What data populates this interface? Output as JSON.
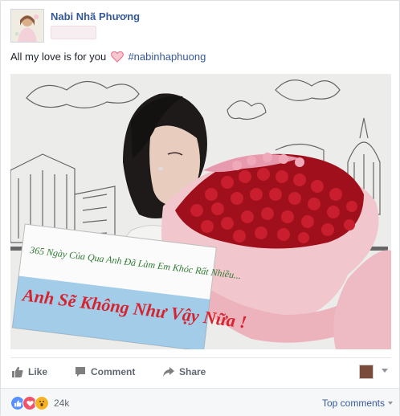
{
  "post": {
    "author": "Nabi Nhã Phương",
    "status_text": "All my love is for you",
    "hashtag": "#nabinhaphuong",
    "photo_sign_line1": "365 Ngày Của Qua Anh Đã Làm Em Khóc Rất Nhiều...",
    "photo_sign_line2": "Anh Sẽ Không Như Vậy Nữa !"
  },
  "actions": {
    "like": "Like",
    "comment": "Comment",
    "share": "Share"
  },
  "footer": {
    "reaction_count": "24k",
    "top_comments": "Top comments"
  },
  "colors": {
    "link": "#365899",
    "reaction_like": "#5890ff",
    "reaction_love": "#f25268",
    "reaction_wow": "#f7b125"
  }
}
